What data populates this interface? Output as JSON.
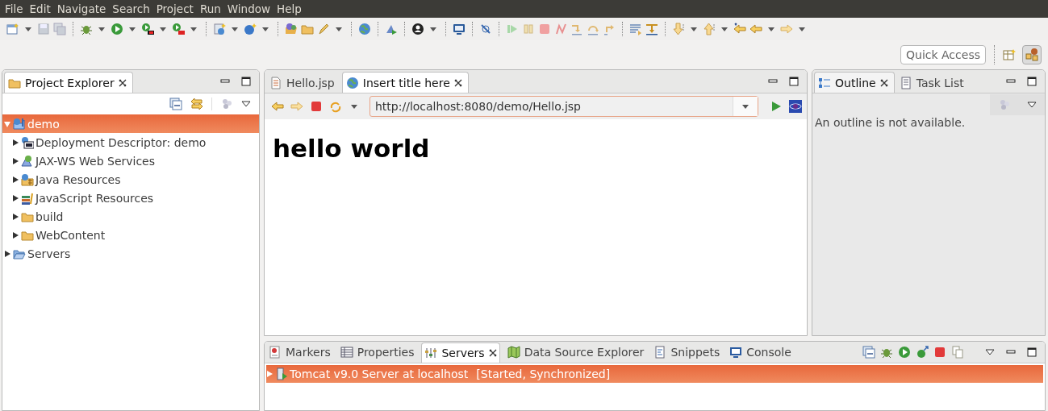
{
  "menu_bar": [
    "File",
    "Edit",
    "Navigate",
    "Search",
    "Project",
    "Run",
    "Window",
    "Help"
  ],
  "quick_access": {
    "placeholder": "Quick Access"
  },
  "project_explorer": {
    "tab": {
      "label": "Project Explorer",
      "selected": true
    },
    "tree": [
      {
        "label": "demo",
        "kind": "project",
        "expanded": true,
        "selected": true,
        "children": [
          {
            "label": "Deployment Descriptor: demo",
            "kind": "descriptor",
            "expanded": false,
            "selected": false
          },
          {
            "label": "JAX-WS Web Services",
            "kind": "webservice",
            "expanded": false,
            "selected": false
          },
          {
            "label": "Java Resources",
            "kind": "javares",
            "expanded": false,
            "selected": false
          },
          {
            "label": "JavaScript Resources",
            "kind": "jsres",
            "expanded": false,
            "selected": false
          },
          {
            "label": "build",
            "kind": "folder",
            "expanded": false,
            "selected": false
          },
          {
            "label": "WebContent",
            "kind": "folder",
            "expanded": false,
            "selected": false
          }
        ]
      },
      {
        "label": "Servers",
        "kind": "openfolder",
        "expanded": false,
        "selected": false
      }
    ]
  },
  "editor": {
    "tabs": [
      {
        "label": "Hello.jsp",
        "kind": "file",
        "selected": false
      },
      {
        "label": "Insert title here",
        "kind": "globe",
        "selected": true
      }
    ],
    "url": "http://localhost:8080/demo/Hello.jsp",
    "heading": "hello world"
  },
  "outline_panel": {
    "tabs": [
      {
        "label": "Outline",
        "kind": "outline",
        "selected": true
      },
      {
        "label": "Task List",
        "kind": "tasks",
        "selected": false
      }
    ],
    "message": "An outline is not available."
  },
  "bottom_panel": {
    "tabs": [
      {
        "label": "Markers",
        "kind": "markers",
        "selected": false
      },
      {
        "label": "Properties",
        "kind": "properties",
        "selected": false
      },
      {
        "label": "Servers",
        "kind": "servers",
        "selected": true
      },
      {
        "label": "Data Source Explorer",
        "kind": "datasource",
        "selected": false
      },
      {
        "label": "Snippets",
        "kind": "snippets",
        "selected": false
      },
      {
        "label": "Console",
        "kind": "console",
        "selected": false
      }
    ],
    "servers": [
      {
        "name": "Tomcat v9.0 Server at localhost",
        "status": "[Started, Synchronized]",
        "selected": true
      }
    ]
  }
}
